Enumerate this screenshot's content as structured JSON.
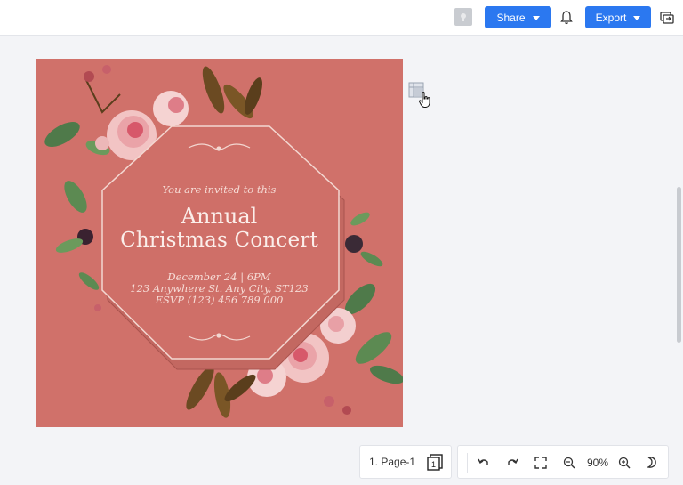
{
  "topbar": {
    "share_label": "Share",
    "export_label": "Export"
  },
  "invitation": {
    "invited_line": "You are invited to this",
    "title_line1": "Annual",
    "title_line2": "Christmas Concert",
    "date_line": "December 24 | 6PM",
    "address_line": "123 Anywhere St. Any City, ST123",
    "rsvp_line": "ESVP (123) 456 789 000"
  },
  "colors": {
    "accent": "#2b78f0",
    "card_background": "#d0716a"
  },
  "bottom_toolbar": {
    "page_label": "1. Page-1",
    "page_count": "1",
    "zoom_level": "90%"
  },
  "icons": [
    "avatar-icon",
    "caret-down-icon",
    "bell-icon",
    "switch-window-icon",
    "grid-icon",
    "hand-cursor-icon",
    "pages-icon",
    "undo-icon",
    "redo-icon",
    "fit-screen-icon",
    "zoom-out-icon",
    "zoom-in-icon",
    "dark-mode-icon"
  ]
}
